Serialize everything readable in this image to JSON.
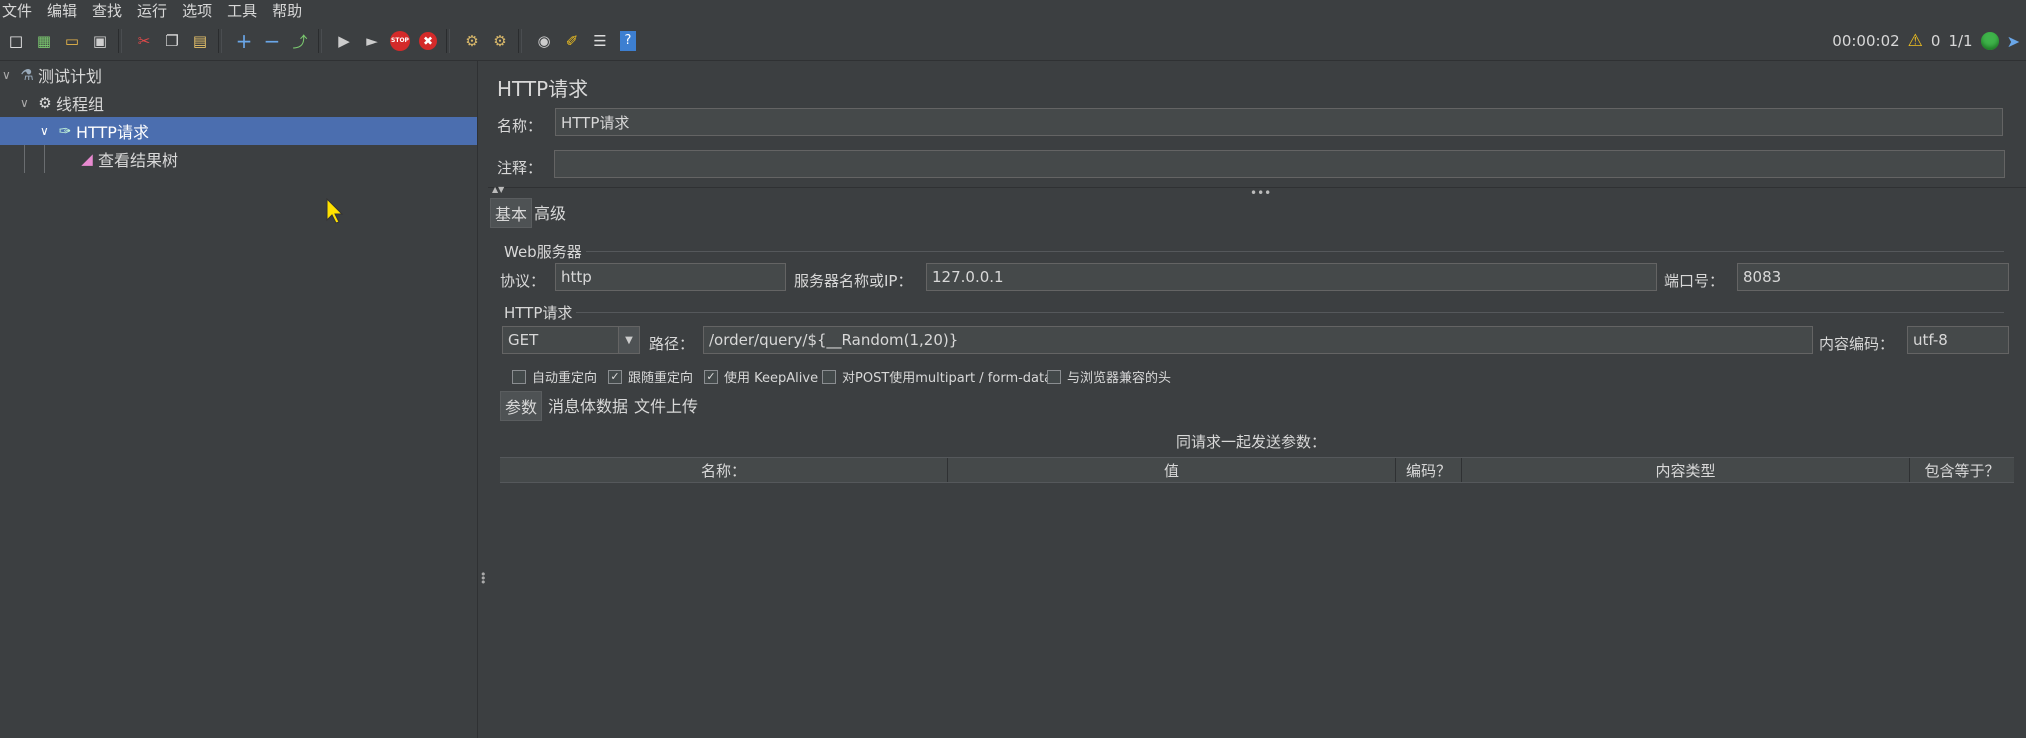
{
  "menu": [
    "文件",
    "编辑",
    "查找",
    "运行",
    "选项",
    "工具",
    "帮助"
  ],
  "toolbar": {
    "icons": [
      "new-icon",
      "templates-icon",
      "open-icon",
      "save-icon",
      "cut-icon",
      "copy-icon",
      "paste-icon",
      "expand-icon",
      "collapse-icon",
      "toggle-icon",
      "start-icon",
      "start-no-pause-icon",
      "stop-icon",
      "shutdown-icon",
      "clear-icon",
      "clear-all-icon",
      "search-icon",
      "reset-search-icon",
      "function-helper-icon",
      "help-icon"
    ]
  },
  "status": {
    "elapsed": "00:00:02",
    "warnings": "0",
    "threads": "1/1"
  },
  "tree": {
    "nodes": [
      {
        "label": "测试计划",
        "icon": "test-plan-icon"
      },
      {
        "label": "线程组",
        "icon": "gear-icon"
      },
      {
        "label": "HTTP请求",
        "icon": "pipette-icon"
      },
      {
        "label": "查看结果树",
        "icon": "graph-icon"
      }
    ]
  },
  "panel": {
    "title": "HTTP请求",
    "name_label": "名称：",
    "name_value": "HTTP请求",
    "comment_label": "注释：",
    "comment_value": "",
    "tabs": [
      "基本",
      "高级"
    ],
    "web_server": {
      "title": "Web服务器",
      "protocol_label": "协议：",
      "protocol_value": "http",
      "server_label": "服务器名称或IP：",
      "server_value": "127.0.0.1",
      "port_label": "端口号：",
      "port_value": "8083"
    },
    "http_request": {
      "title": "HTTP请求",
      "method": "GET",
      "path_label": "路径：",
      "path_value": "/order/query/${__Random(1,20)}",
      "encoding_label": "内容编码：",
      "encoding_value": "utf-8",
      "checkboxes": [
        {
          "label": "自动重定向",
          "checked": false
        },
        {
          "label": "跟随重定向",
          "checked": true
        },
        {
          "label": "使用 KeepAlive",
          "checked": true
        },
        {
          "label": "对POST使用multipart / form-data",
          "checked": false
        },
        {
          "label": "与浏览器兼容的头",
          "checked": false
        }
      ]
    },
    "sub_tabs": [
      "参数",
      "消息体数据",
      "文件上传"
    ],
    "params": {
      "caption": "同请求一起发送参数：",
      "columns": [
        "名称：",
        "值",
        "编码？",
        "内容类型",
        "包含等于？"
      ]
    }
  }
}
